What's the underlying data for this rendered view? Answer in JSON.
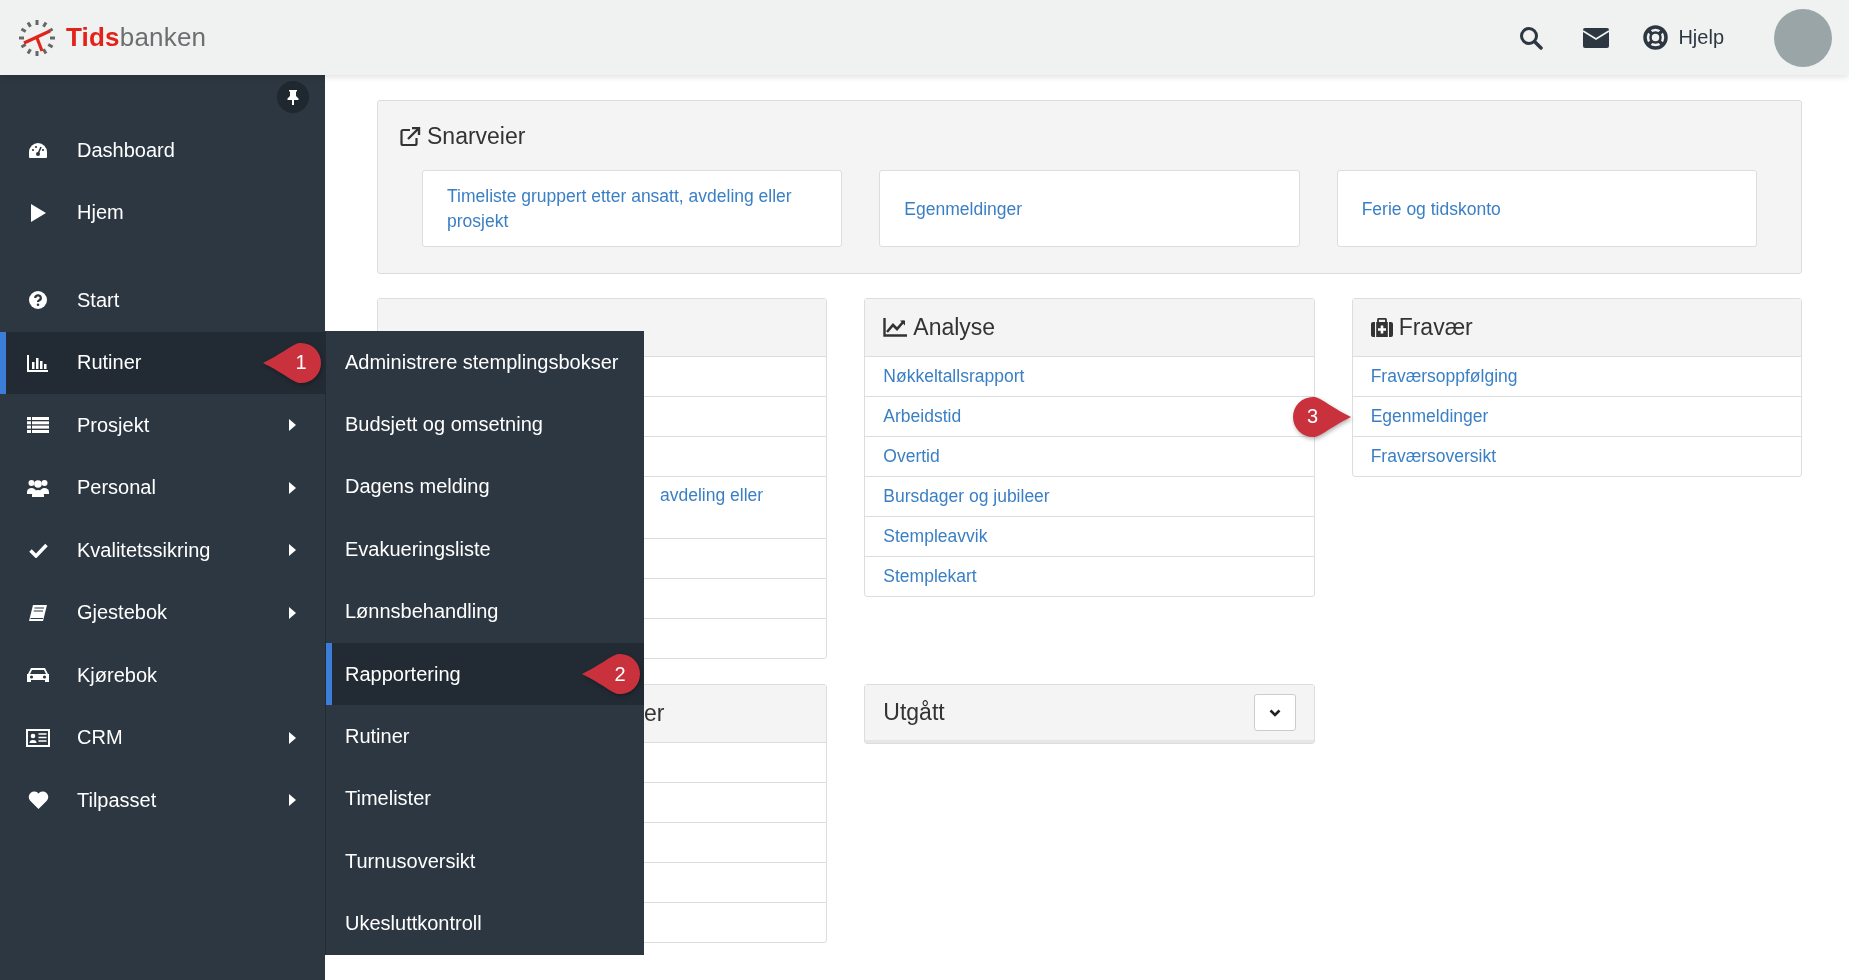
{
  "header": {
    "logo": {
      "prefix": "Tids",
      "suffix": "banken"
    },
    "help_label": "Hjelp"
  },
  "sidebar": {
    "groups": [
      [
        {
          "label": "Dashboard",
          "arrow": false,
          "selected": false
        },
        {
          "label": "Hjem",
          "arrow": false,
          "selected": false
        }
      ],
      [
        {
          "label": "Start",
          "arrow": false,
          "selected": false
        },
        {
          "label": "Rutiner",
          "arrow": false,
          "selected": true,
          "callout": "1"
        },
        {
          "label": "Prosjekt",
          "arrow": true,
          "selected": false
        },
        {
          "label": "Personal",
          "arrow": true,
          "selected": false
        },
        {
          "label": "Kvalitetssikring",
          "arrow": true,
          "selected": false
        },
        {
          "label": "Gjestebok",
          "arrow": true,
          "selected": false
        },
        {
          "label": "Kjørebok",
          "arrow": false,
          "selected": false
        },
        {
          "label": "CRM",
          "arrow": true,
          "selected": false
        },
        {
          "label": "Tilpasset",
          "arrow": true,
          "selected": false
        }
      ]
    ]
  },
  "submenu": [
    {
      "label": "Administrere stemplingsbokser",
      "selected": false
    },
    {
      "label": "Budsjett og omsetning",
      "selected": false
    },
    {
      "label": "Dagens melding",
      "selected": false
    },
    {
      "label": "Evakueringsliste",
      "selected": false
    },
    {
      "label": "Lønnsbehandling",
      "selected": false
    },
    {
      "label": "Rapportering",
      "selected": true,
      "callout": "2"
    },
    {
      "label": "Rutiner",
      "selected": false
    },
    {
      "label": "Timelister",
      "selected": false
    },
    {
      "label": "Turnusoversikt",
      "selected": false
    },
    {
      "label": "Ukesluttkontroll",
      "selected": false
    }
  ],
  "shortcuts": {
    "title": "Snarveier",
    "links": [
      "Timeliste gruppert etter ansatt, avdeling eller prosjekt",
      "Egenmeldinger",
      "Ferie og tidskonto"
    ]
  },
  "timelister_card": {
    "rows": [
      {},
      {},
      {},
      {
        "fragment": "avdeling eller"
      },
      {},
      {},
      {}
    ]
  },
  "analyse": {
    "title": "Analyse",
    "links": [
      {
        "label": "Nøkkeltallsrapport"
      },
      {
        "label": "Arbeidstid"
      },
      {
        "label": "Overtid"
      },
      {
        "label": "Bursdager og jubileer"
      },
      {
        "label": "Stempleavvik"
      },
      {
        "label": "Stemplekart"
      }
    ]
  },
  "fravaer": {
    "title": "Fravær",
    "links": [
      {
        "label": "Fraværsoppfølging"
      },
      {
        "label": "Egenmeldinger",
        "callout": "3"
      },
      {
        "label": "Fraværsoversikt"
      }
    ]
  },
  "lower_left_card": {
    "title_fragment": "er",
    "rows": [
      {},
      {},
      {},
      {},
      {}
    ]
  },
  "utgatt": {
    "title": "Utgått",
    "expanded": false
  }
}
